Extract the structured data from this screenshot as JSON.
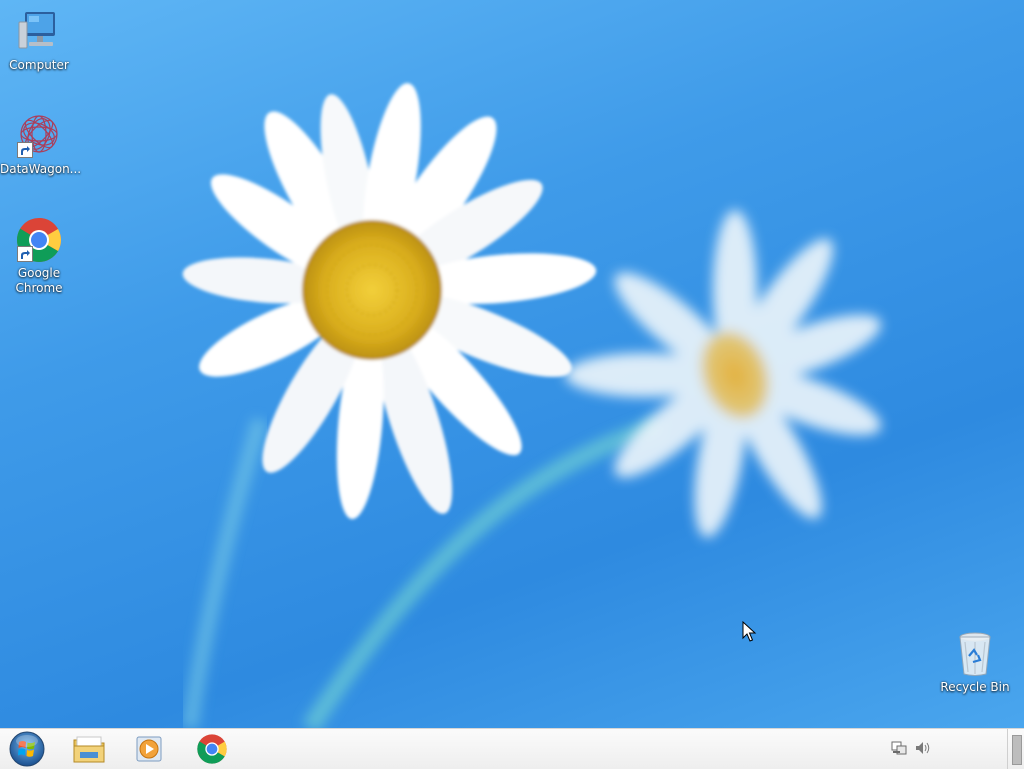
{
  "desktop": {
    "icons": [
      {
        "label": "Computer",
        "icon": "computer-icon"
      },
      {
        "label": "DataWagon...",
        "icon": "datawagon-icon"
      },
      {
        "label": "Google\nChrome",
        "label_line1": "Google",
        "label_line2": "Chrome",
        "icon": "chrome-icon"
      },
      {
        "label": "Recycle Bin",
        "icon": "recycle-bin-icon"
      }
    ]
  },
  "taskbar": {
    "start": {
      "icon": "windows-start-orb-icon"
    },
    "pinned": [
      {
        "icon": "file-explorer-icon"
      },
      {
        "icon": "media-player-icon"
      },
      {
        "icon": "chrome-icon"
      }
    ],
    "tray": [
      {
        "icon": "network-icon"
      },
      {
        "icon": "volume-icon"
      }
    ],
    "clock": {
      "time": "",
      "date": ""
    }
  },
  "colors": {
    "sky": "#3f9be9",
    "taskbar": "#f2f2f2",
    "petal": "#ffffff",
    "flower_center": "#e2b81d"
  }
}
